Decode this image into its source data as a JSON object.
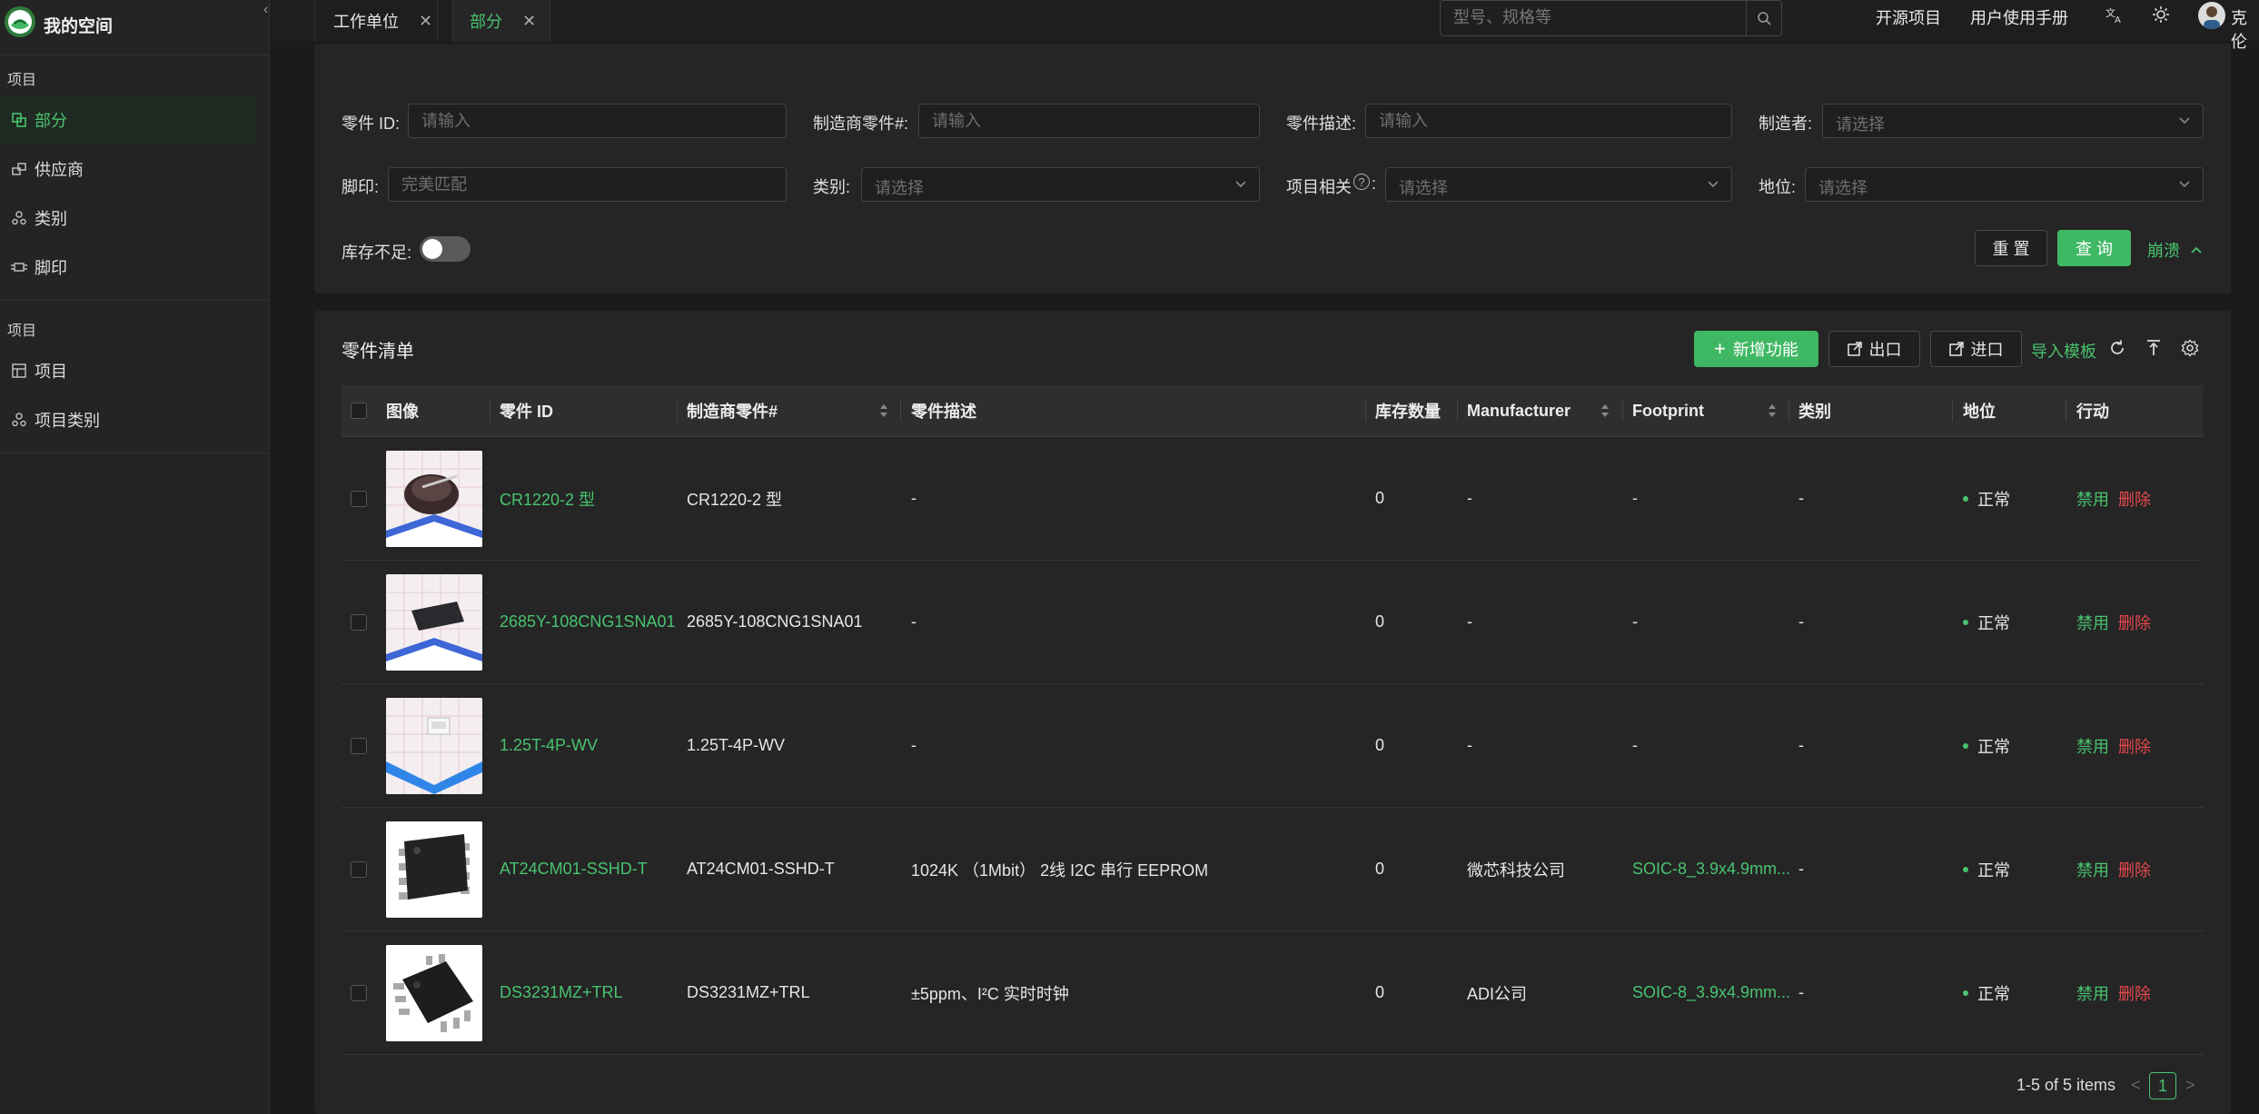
{
  "brand": {
    "title": "我的空间"
  },
  "sidebar": {
    "group1_label": "项目",
    "group2_label": "项目",
    "items": [
      {
        "label": "部分",
        "icon": "parts-icon"
      },
      {
        "label": "供应商",
        "icon": "supplier-icon"
      },
      {
        "label": "类别",
        "icon": "category-icon"
      },
      {
        "label": "脚印",
        "icon": "footprint-icon"
      }
    ],
    "items2": [
      {
        "label": "项目",
        "icon": "project-icon"
      },
      {
        "label": "项目类别",
        "icon": "project-category-icon"
      }
    ]
  },
  "tabs": [
    {
      "label": "工作单位"
    },
    {
      "label": "部分"
    }
  ],
  "header": {
    "search_placeholder": "型号、规格等",
    "open_source": "开源项目",
    "manual": "用户使用手册",
    "username": "克伦"
  },
  "filters": {
    "part_id_label": "零件 ID:",
    "part_id_placeholder": "请输入",
    "mpn_label": "制造商零件#:",
    "mpn_placeholder": "请输入",
    "desc_label": "零件描述:",
    "desc_placeholder": "请输入",
    "manufacturer_label": "制造者:",
    "manufacturer_placeholder": "请选择",
    "footprint_label": "脚印:",
    "footprint_placeholder": "完美匹配",
    "category_label": "类别:",
    "category_placeholder": "请选择",
    "project_label": "项目相关",
    "project_colon": ":",
    "project_placeholder": "请选择",
    "status_label": "地位:",
    "status_placeholder": "请选择",
    "low_stock_label": "库存不足:",
    "reset": "重 置",
    "query": "查 询",
    "collapse": "崩溃"
  },
  "list": {
    "title": "零件清单",
    "add": "新增功能",
    "export": "出口",
    "import": "进口",
    "import_template": "导入模板"
  },
  "table": {
    "headers": [
      "图像",
      "零件 ID",
      "制造商零件#",
      "零件描述",
      "库存数量",
      "Manufacturer",
      "Footprint",
      "类别",
      "地位",
      "行动"
    ],
    "rows": [
      {
        "id": "CR1220-2 型",
        "mpn": "CR1220-2 型",
        "desc": "-",
        "qty": "0",
        "mfr": "-",
        "footprint": "-",
        "category": "-",
        "status": "正常",
        "disable": "禁用",
        "delete": "删除"
      },
      {
        "id": "2685Y-108CNG1SNA01",
        "mpn": "2685Y-108CNG1SNA01",
        "desc": "-",
        "qty": "0",
        "mfr": "-",
        "footprint": "-",
        "category": "-",
        "status": "正常",
        "disable": "禁用",
        "delete": "删除"
      },
      {
        "id": "1.25T-4P-WV",
        "mpn": "1.25T-4P-WV",
        "desc": "-",
        "qty": "0",
        "mfr": "-",
        "footprint": "-",
        "category": "-",
        "status": "正常",
        "disable": "禁用",
        "delete": "删除"
      },
      {
        "id": "AT24CM01-SSHD-T",
        "mpn": "AT24CM01-SSHD-T",
        "desc": "1024K （1Mbit） 2线 I2C 串行 EEPROM",
        "qty": "0",
        "mfr": "微芯科技公司",
        "footprint": "SOIC-8_3.9x4.9mm...",
        "category": "-",
        "status": "正常",
        "disable": "禁用",
        "delete": "删除"
      },
      {
        "id": "DS3231MZ+TRL",
        "mpn": "DS3231MZ+TRL",
        "desc": "±5ppm、I²C 实时时钟",
        "qty": "0",
        "mfr": "ADI公司",
        "footprint": "SOIC-8_3.9x4.9mm...",
        "category": "-",
        "status": "正常",
        "disable": "禁用",
        "delete": "删除"
      }
    ]
  },
  "pagination": {
    "total": "1-5 of 5 items",
    "page": "1",
    "prev": "<",
    "next": ">"
  },
  "colors": {
    "accent": "#49c36f",
    "danger": "#e5484d",
    "background": "#1b1b1b",
    "panel": "#252525"
  }
}
